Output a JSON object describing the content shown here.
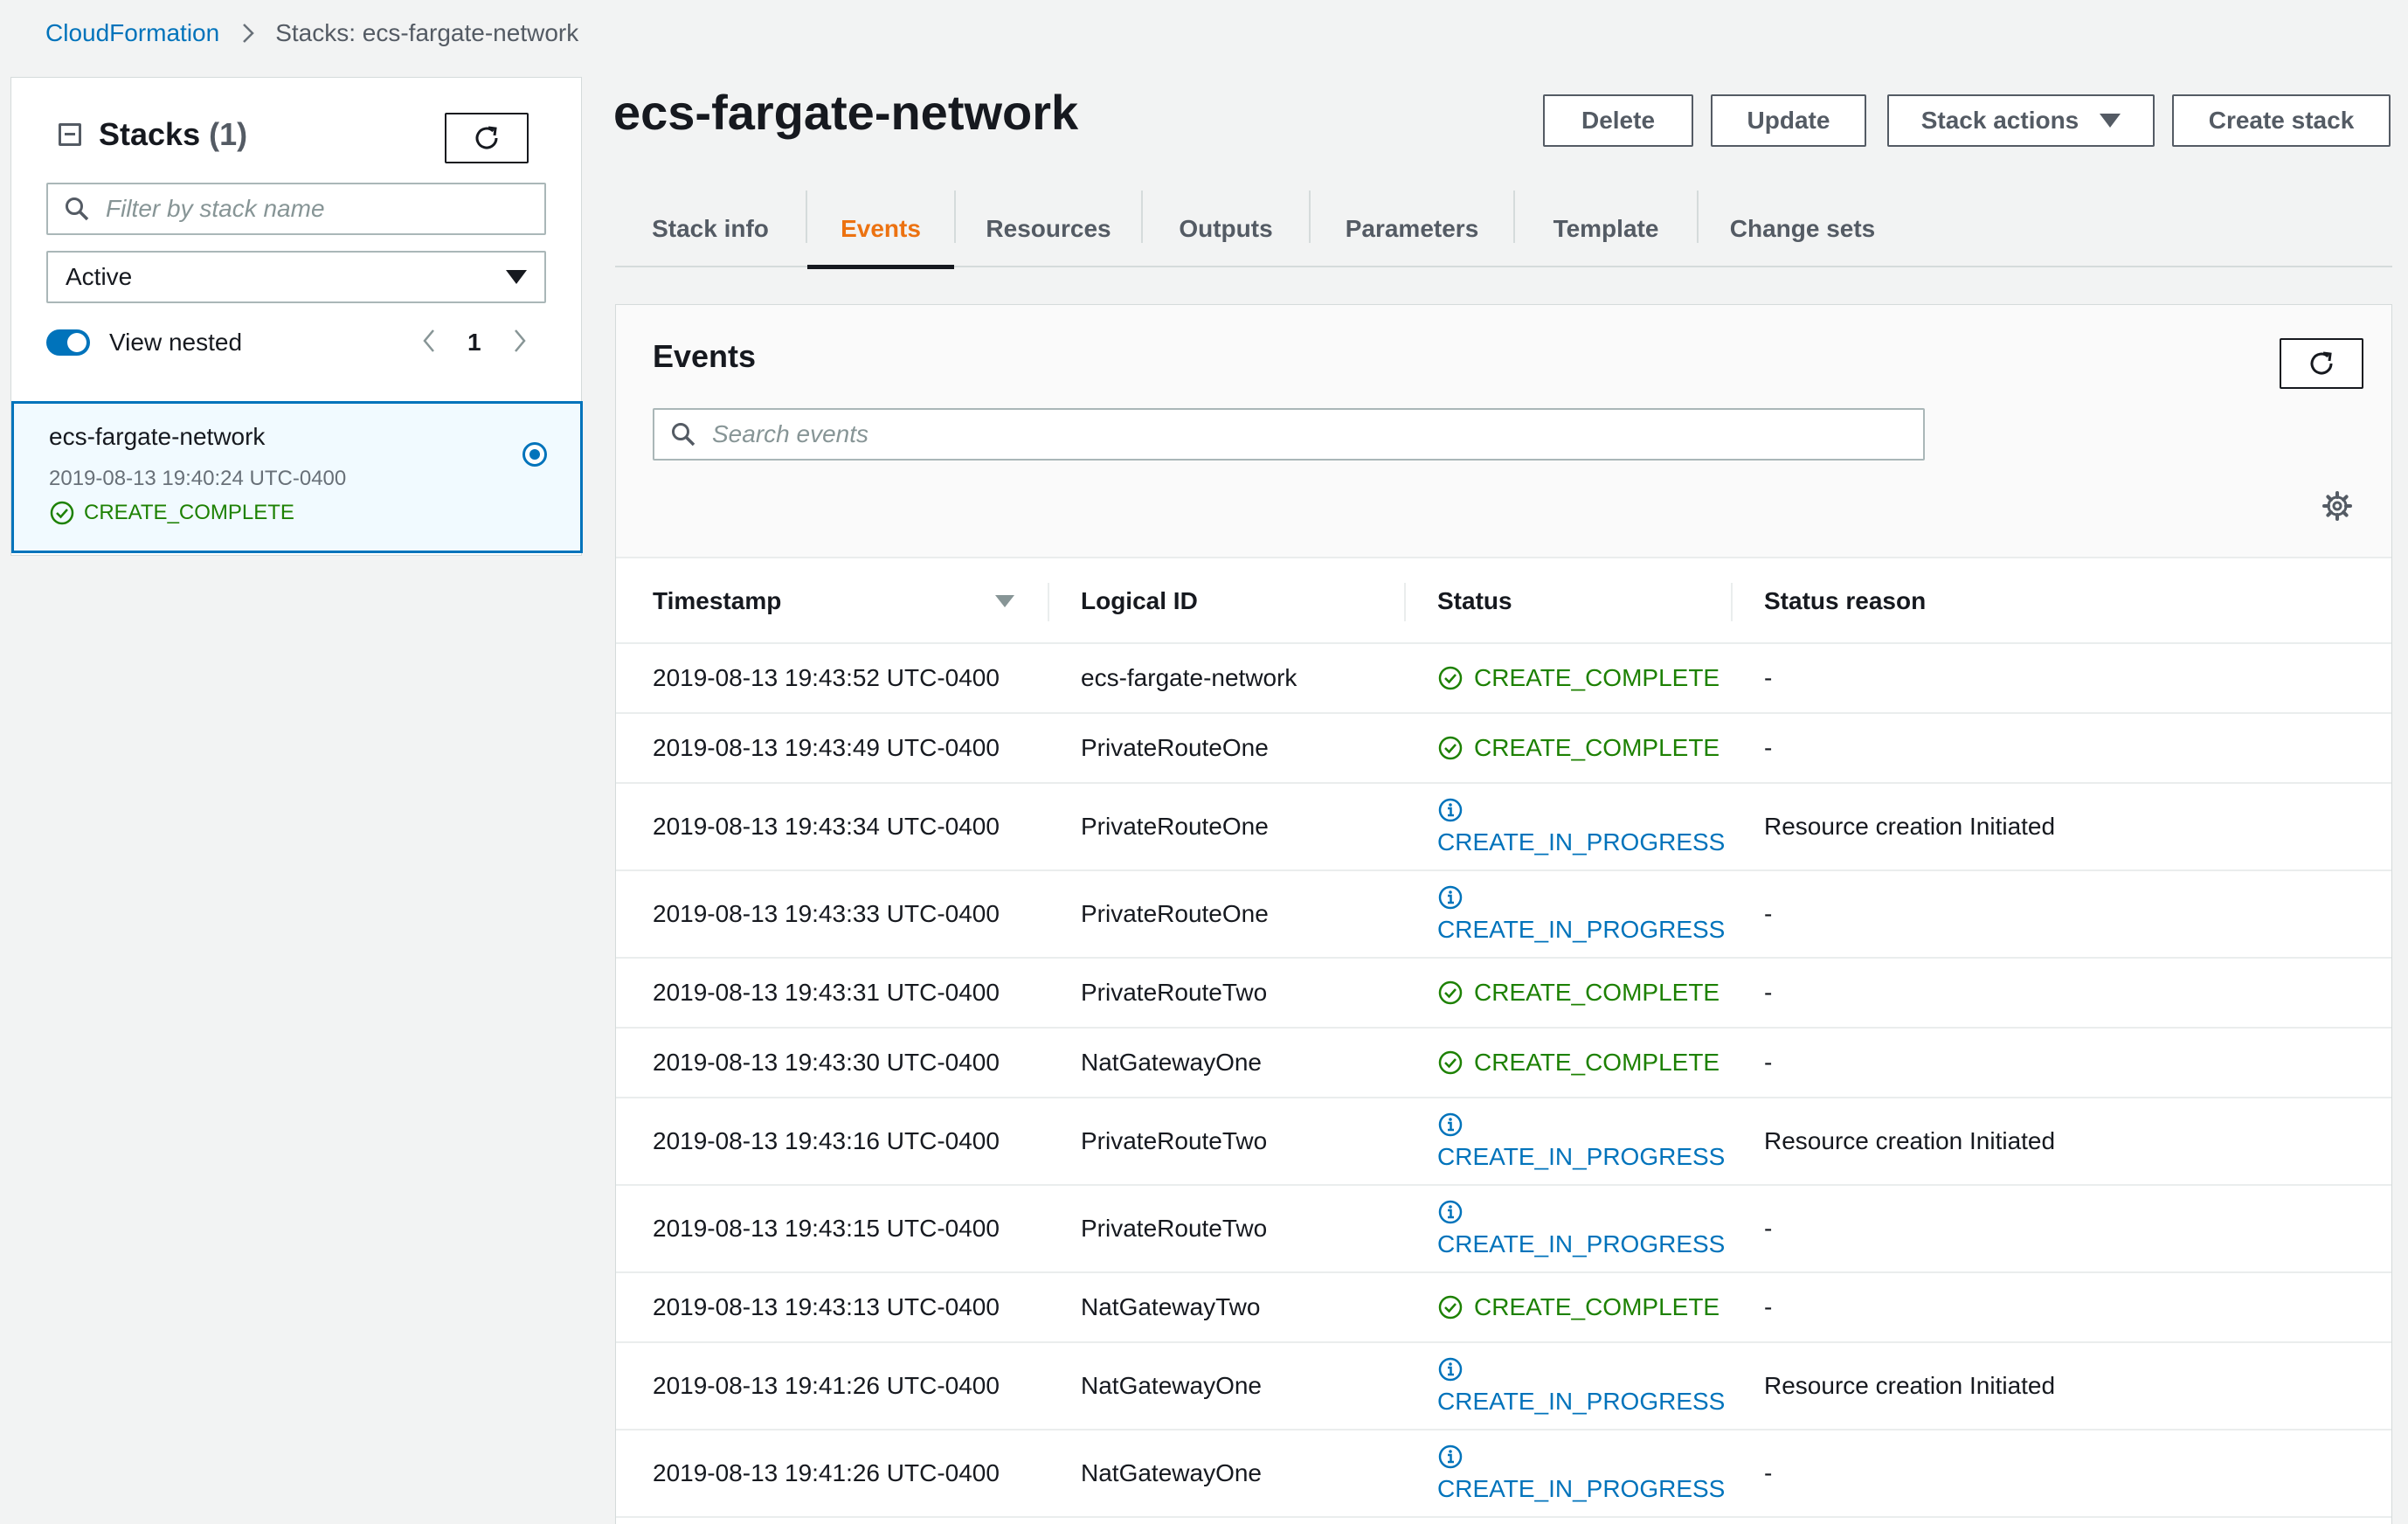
{
  "breadcrumb": {
    "root": "CloudFormation",
    "current": "Stacks: ecs-fargate-network"
  },
  "sidebar": {
    "title": "Stacks",
    "count": "(1)",
    "filter_placeholder": "Filter by stack name",
    "filter_status": "Active",
    "view_nested_label": "View nested",
    "page_number": "1",
    "stack": {
      "name": "ecs-fargate-network",
      "created": "2019-08-13 19:40:24 UTC-0400",
      "status": "CREATE_COMPLETE"
    }
  },
  "page": {
    "title": "ecs-fargate-network",
    "buttons": {
      "delete": "Delete",
      "update": "Update",
      "stack_actions": "Stack actions",
      "create_stack": "Create stack"
    }
  },
  "tabs": [
    {
      "label": "Stack info"
    },
    {
      "label": "Events"
    },
    {
      "label": "Resources"
    },
    {
      "label": "Outputs"
    },
    {
      "label": "Parameters"
    },
    {
      "label": "Template"
    },
    {
      "label": "Change sets"
    }
  ],
  "events": {
    "title": "Events",
    "search_placeholder": "Search events",
    "columns": {
      "timestamp": "Timestamp",
      "logical_id": "Logical ID",
      "status": "Status",
      "status_reason": "Status reason"
    },
    "rows": [
      {
        "timestamp": "2019-08-13 19:43:52 UTC-0400",
        "logical_id": "ecs-fargate-network",
        "status": "CREATE_COMPLETE",
        "reason": "-"
      },
      {
        "timestamp": "2019-08-13 19:43:49 UTC-0400",
        "logical_id": "PrivateRouteOne",
        "status": "CREATE_COMPLETE",
        "reason": "-"
      },
      {
        "timestamp": "2019-08-13 19:43:34 UTC-0400",
        "logical_id": "PrivateRouteOne",
        "status": "CREATE_IN_PROGRESS",
        "reason": "Resource creation Initiated"
      },
      {
        "timestamp": "2019-08-13 19:43:33 UTC-0400",
        "logical_id": "PrivateRouteOne",
        "status": "CREATE_IN_PROGRESS",
        "reason": "-"
      },
      {
        "timestamp": "2019-08-13 19:43:31 UTC-0400",
        "logical_id": "PrivateRouteTwo",
        "status": "CREATE_COMPLETE",
        "reason": "-"
      },
      {
        "timestamp": "2019-08-13 19:43:30 UTC-0400",
        "logical_id": "NatGatewayOne",
        "status": "CREATE_COMPLETE",
        "reason": "-"
      },
      {
        "timestamp": "2019-08-13 19:43:16 UTC-0400",
        "logical_id": "PrivateRouteTwo",
        "status": "CREATE_IN_PROGRESS",
        "reason": "Resource creation Initiated"
      },
      {
        "timestamp": "2019-08-13 19:43:15 UTC-0400",
        "logical_id": "PrivateRouteTwo",
        "status": "CREATE_IN_PROGRESS",
        "reason": "-"
      },
      {
        "timestamp": "2019-08-13 19:43:13 UTC-0400",
        "logical_id": "NatGatewayTwo",
        "status": "CREATE_COMPLETE",
        "reason": "-"
      },
      {
        "timestamp": "2019-08-13 19:41:26 UTC-0400",
        "logical_id": "NatGatewayOne",
        "status": "CREATE_IN_PROGRESS",
        "reason": "Resource creation Initiated"
      },
      {
        "timestamp": "2019-08-13 19:41:26 UTC-0400",
        "logical_id": "NatGatewayOne",
        "status": "CREATE_IN_PROGRESS",
        "reason": "-"
      }
    ]
  },
  "colors": {
    "link": "#0073bb",
    "success": "#1d8102",
    "active_tab": "#ec7211"
  }
}
